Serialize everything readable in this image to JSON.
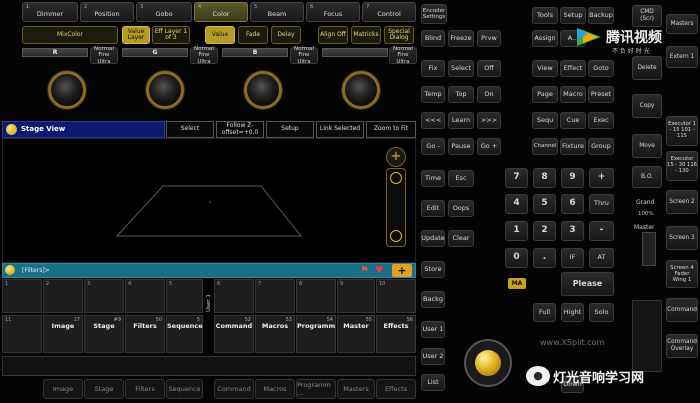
{
  "presets": {
    "tabs": [
      {
        "num": "1",
        "label": "Dimmer"
      },
      {
        "num": "2",
        "label": "Position"
      },
      {
        "num": "3",
        "label": "Gobo"
      },
      {
        "num": "4",
        "label": "Color"
      },
      {
        "num": "5",
        "label": "Beam"
      },
      {
        "num": "6",
        "label": "Focus"
      },
      {
        "num": "7",
        "label": "Control"
      }
    ],
    "active_index": 3
  },
  "feature_bar": {
    "mixcolor": "MixColor",
    "value_layer": "Value Layer",
    "eff_layer": "Eff Layer 1 of 3",
    "value": "Value",
    "fade": "Fade",
    "delay": "Delay",
    "align": "Align Off",
    "matricks": "Matricks",
    "special_dialog": "Special Dialog"
  },
  "attributes": [
    {
      "name": "R",
      "mode": "Normal Fine Ultra"
    },
    {
      "name": "G",
      "mode": "Normal Fine Ultra"
    },
    {
      "name": "B",
      "mode": "Normal Fine Ultra"
    },
    {
      "name": "",
      "mode": "Normal Fine Ultra"
    }
  ],
  "stage_view": {
    "title": "Stage View",
    "buttons": [
      "Select",
      "Follow Z-offset=+0.0",
      "Setup",
      "Link Selected",
      "Zoom to Fit"
    ]
  },
  "filters_bar": {
    "label": "[Filters]>"
  },
  "pool": {
    "row1": [
      "1",
      "2",
      "3",
      "4",
      "5",
      "6",
      "7",
      "8",
      "9",
      "10"
    ],
    "row2": [
      {
        "num": "",
        "title": "Image",
        "count": "17"
      },
      {
        "num": "",
        "title": "Stage",
        "count": "#9"
      },
      {
        "num": "",
        "title": "Filters",
        "count": "50"
      },
      {
        "num": "",
        "title": "Sequence",
        "count": "5"
      },
      {
        "num": "",
        "title": "Command",
        "count": "52"
      },
      {
        "num": "",
        "title": "Macros",
        "count": "53"
      },
      {
        "num": "",
        "title": "Programm",
        "count": "54"
      },
      {
        "num": "",
        "title": "Master",
        "count": "55"
      },
      {
        "num": "",
        "title": "Effects",
        "count": "56"
      }
    ],
    "user": "User 1",
    "row2_first": "11"
  },
  "bottom_bar": [
    "Image",
    "Stage",
    "Filters",
    "Sequence",
    "Command",
    "Macros",
    "Programm ...",
    "Masters",
    "Effects"
  ],
  "encoder_settings": "Encoder Settings",
  "left_keys": [
    [
      "Blind",
      "Freeze",
      "Prvw"
    ],
    [
      "Fix",
      "Select",
      "Off"
    ],
    [
      "Temp",
      "Top",
      "On"
    ],
    [
      "<<<",
      "Learn",
      ">>>"
    ],
    [
      "Go -",
      "Pause",
      "Go +"
    ],
    [
      "Time",
      "Esc"
    ],
    [
      "Edit",
      "Oops"
    ],
    [
      "Update",
      "Clear"
    ],
    [
      "Store"
    ],
    [
      "Backg"
    ],
    [
      "User 1"
    ],
    [
      "User 2"
    ],
    [
      "List"
    ]
  ],
  "right_keys": [
    [
      "Tools",
      "Setup",
      "Backup"
    ],
    [
      "Assign",
      "A...",
      ""
    ],
    [
      "View",
      "Effect",
      "Goto"
    ],
    [
      "Page",
      "Macro",
      "Preset"
    ],
    [
      "Sequ",
      "Cue",
      "Exec"
    ],
    [
      "Channel",
      "Fixture",
      "Group"
    ]
  ],
  "numpad": [
    [
      "7",
      "8",
      "9",
      "+"
    ],
    [
      "4",
      "5",
      "6",
      "Thru"
    ],
    [
      "1",
      "2",
      "3",
      "-"
    ],
    [
      "0",
      ".",
      "IF",
      "AT"
    ]
  ],
  "ma": "MA",
  "please": "Please",
  "full_keys": [
    "Full",
    "Hight",
    "Solo"
  ],
  "down": "Down",
  "side": {
    "cmd": "CMD (Scr)",
    "masters": "Masters",
    "extern": "Extern 1",
    "delete": "Delete",
    "copy": "Copy",
    "exec1": "Executor 1 - 15 101 - 115",
    "exec2": "Executor 15 - 30 116 - 130",
    "move": "Move",
    "bo": "B.O.",
    "grand": "Grand",
    "percent": "100%",
    "master": "Master",
    "screen2": "Screen 2",
    "screen3": "Screen 3",
    "screen4": "Screen 4 Fader Wing 1",
    "command": "Command",
    "cmd_overlay": "Command Overlay"
  },
  "watermarks": {
    "tencent": "腾讯视频",
    "tencent_sub": "不 负 好 时 光",
    "www": "www.XSplit.com",
    "bottom": "灯光音响学习网"
  },
  "colors": {
    "accent": "#e2b422",
    "bar_blue": "#0d1b6e",
    "panel": "#1b1b1b"
  }
}
